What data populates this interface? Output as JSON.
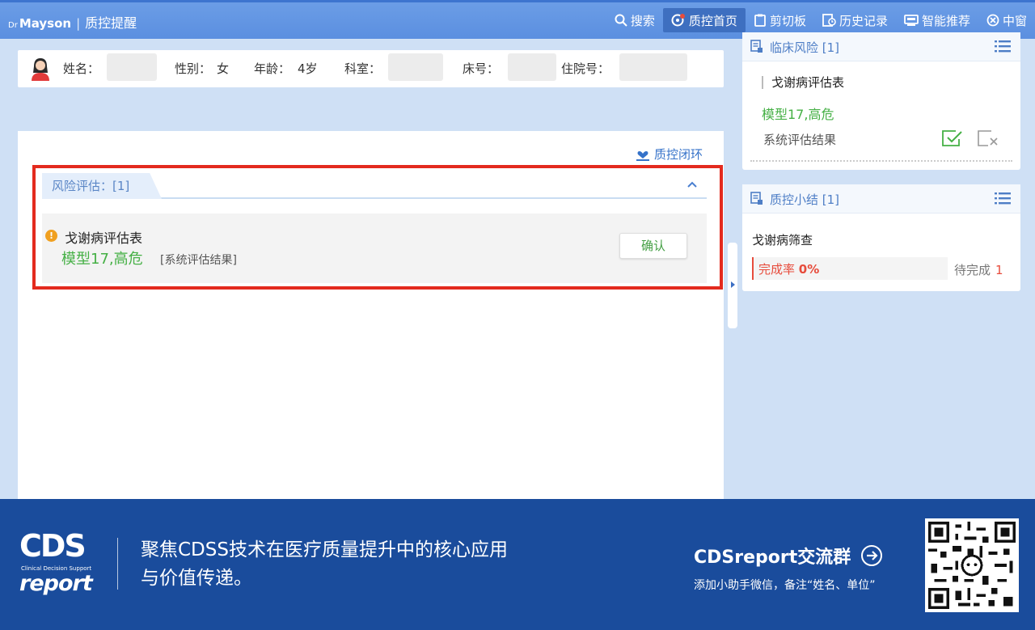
{
  "topbar": {
    "brand_prefix": "Dr",
    "brand_name": "Mayson",
    "brand_sep": "|",
    "module_title": "质控提醒",
    "nav": [
      {
        "label": "搜索",
        "icon": "search-icon"
      },
      {
        "label": "质控首页",
        "icon": "qc-home-icon",
        "active": true
      },
      {
        "label": "剪切板",
        "icon": "clipboard-icon"
      },
      {
        "label": "历史记录",
        "icon": "history-icon"
      },
      {
        "label": "智能推荐",
        "icon": "recommend-icon"
      },
      {
        "label": "中窗",
        "icon": "window-icon"
      }
    ]
  },
  "patient": {
    "name_label": "姓名：",
    "gender_label": "性别：",
    "gender_value": "女",
    "age_label": "年龄：",
    "age_value": "4岁",
    "dept_label": "科室：",
    "bed_label": "床号：",
    "inpatient_label": "住院号："
  },
  "main": {
    "qc_loop_label": "质控闭环",
    "risk_tab_label": "风险评估：[1]",
    "risk_item": {
      "name": "戈谢病评估表",
      "result": "模型17,高危",
      "source": "[系统评估结果]",
      "confirm_label": "确认"
    }
  },
  "right": {
    "clinical_risk": {
      "title": "临床风险 [1]",
      "item_title": "戈谢病评估表",
      "item_result": "模型17,高危",
      "item_source": "系统评估结果"
    },
    "qc_summary": {
      "title": "质控小结 [1]",
      "item_title": "戈谢病筛查",
      "rate_label": "完成率",
      "rate_value": "0%",
      "pending_label": "待完成",
      "pending_count": "1"
    }
  },
  "footer": {
    "logo_main": "CDS",
    "logo_sub": "Clinical Decision Support",
    "logo_report": "report",
    "slogan_line1": "聚焦CDSS技术在医疗质量提升中的核心应用",
    "slogan_line2": "与价值传递。",
    "group_title": "CDSreport交流群",
    "group_sub": "添加小助手微信，备注“姓名、单位”"
  },
  "colors": {
    "topbar": "#5b8fe0",
    "highlight_border": "#e32a1e",
    "success_green": "#45b045",
    "danger_red": "#e74c3c",
    "footer_bg": "#1a4c9c"
  }
}
